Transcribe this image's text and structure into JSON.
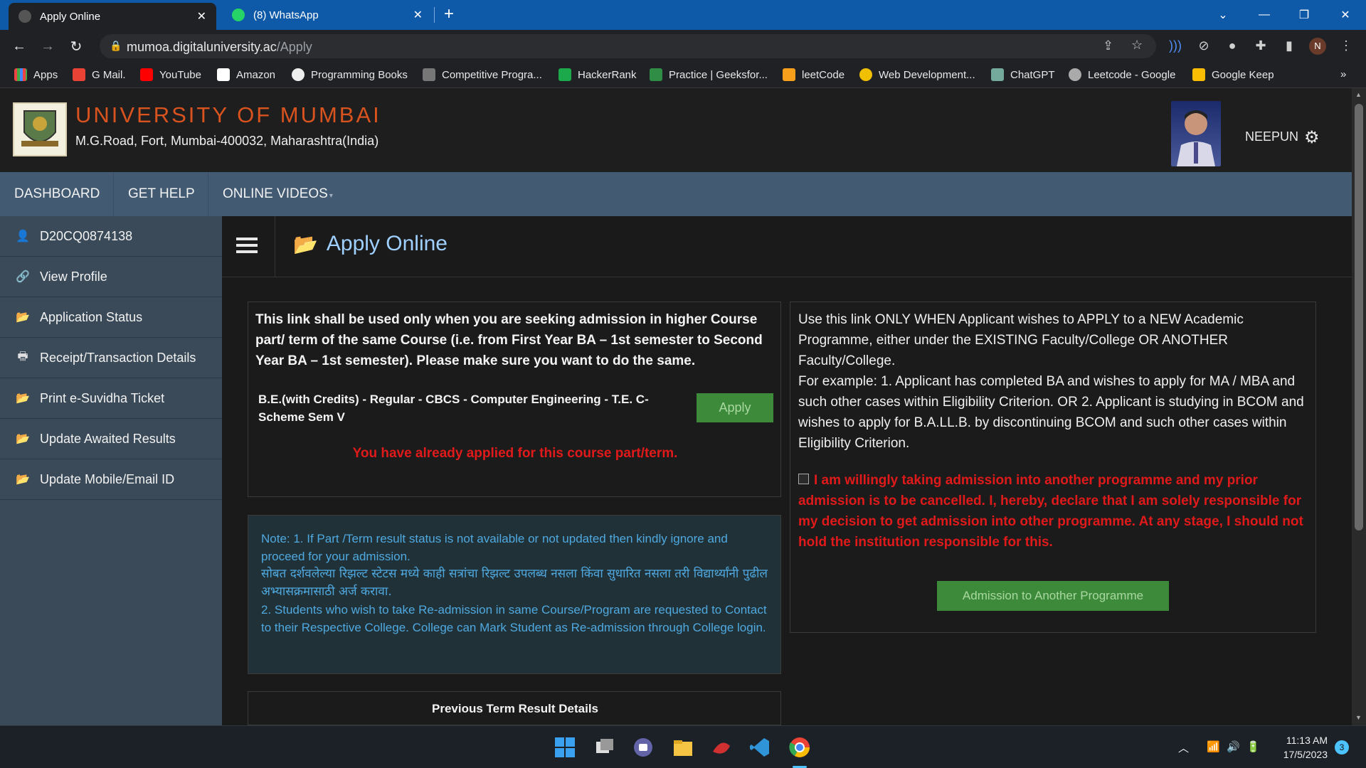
{
  "browser": {
    "tabs": [
      {
        "title": "Apply Online",
        "active": true
      },
      {
        "title": "(8) WhatsApp",
        "active": false
      }
    ],
    "new_tab": "+",
    "url_host": "mumoa.digitaluniversity.ac",
    "url_path": "/Apply",
    "profile_initial": "N",
    "bookmarks": [
      "Apps",
      "G Mail.",
      "YouTube",
      "Amazon",
      "Programming Books",
      "Competitive Progra...",
      "HackerRank",
      "Practice | Geeksfor...",
      "leetCode",
      "Web Development...",
      "ChatGPT",
      "Leetcode - Google",
      "Google Keep"
    ],
    "bookmarks_more": "»"
  },
  "header": {
    "title": "UNIVERSITY OF MUMBAI",
    "address": "M.G.Road, Fort, Mumbai-400032, Maharashtra(India)",
    "username": "NEEPUN"
  },
  "nav": {
    "dashboard": "DASHBOARD",
    "get_help": "GET HELP",
    "online_videos": "ONLINE VIDEOS"
  },
  "sidebar": {
    "items": [
      {
        "label": "D20CQ0874138",
        "icon": "user-icon"
      },
      {
        "label": "View Profile",
        "icon": "link-icon"
      },
      {
        "label": "Application Status",
        "icon": "folder-icon"
      },
      {
        "label": "Receipt/Transaction Details",
        "icon": "print-icon"
      },
      {
        "label": "Print e-Suvidha Ticket",
        "icon": "folder-icon"
      },
      {
        "label": "Update Awaited Results",
        "icon": "folder-icon"
      },
      {
        "label": "Update Mobile/Email ID",
        "icon": "folder-icon"
      }
    ]
  },
  "main": {
    "heading": "Apply Online",
    "left_panel": {
      "text": "This link shall be used only when you are seeking admission in higher Course part/ term of the same Course (i.e. from First Year BA – 1st semester to Second Year BA – 1st semester). Please make sure you want to do the same.",
      "course": "B.E.(with Credits) - Regular - CBCS - Computer Engineering - T.E. C-Scheme Sem V",
      "apply_button": "Apply",
      "warning": "You have already applied for this course part/term."
    },
    "note": {
      "line1": "Note: 1. If Part /Term result status is not available or not updated then kindly ignore and proceed for your admission.",
      "line2": "सोबत दर्शवलेल्या रिझल्ट स्टेटस मध्ये काही सत्रांचा रिझल्ट उपलब्ध नसला किंवा सुधारित नसला तरी विद्यार्थ्यांनी पुढील अभ्यासक्रमासाठी अर्ज करावा.",
      "line3": "2. Students who wish to take Re-admission in same Course/Program are requested to Contact to their Respective College. College can Mark Student as Re-admission through College login."
    },
    "previous_term_title": "Previous Term Result Details",
    "right_panel": {
      "text1": "Use this link ONLY WHEN Applicant wishes to APPLY to a NEW Academic Programme, either under the EXISTING Faculty/College OR ANOTHER Faculty/College.",
      "text2": "For example: 1. Applicant has completed BA and wishes to apply for MA / MBA and such other cases within Eligibility Criterion. OR 2. Applicant is studying in BCOM and wishes to apply for B.A.LL.B. by discontinuing BCOM and such other cases within Eligibility Criterion.",
      "declaration": "I am willingly taking admission into another programme and my prior admission is to be cancelled. I, hereby, declare that I am solely responsible for my decision to get admission into other programme. At any stage, I should not hold the institution responsible for this.",
      "button": "Admission to Another Programme"
    }
  },
  "taskbar": {
    "time": "11:13 AM",
    "date": "17/5/2023",
    "notifications": "3"
  },
  "colors": {
    "brand_title": "#d9531e",
    "nav_bg": "#425a72",
    "sidebar_bg": "#3a4a58",
    "warning_red": "#e01a1a",
    "button_green": "#3d8a3a",
    "heading_blue": "#9fd0ff"
  }
}
